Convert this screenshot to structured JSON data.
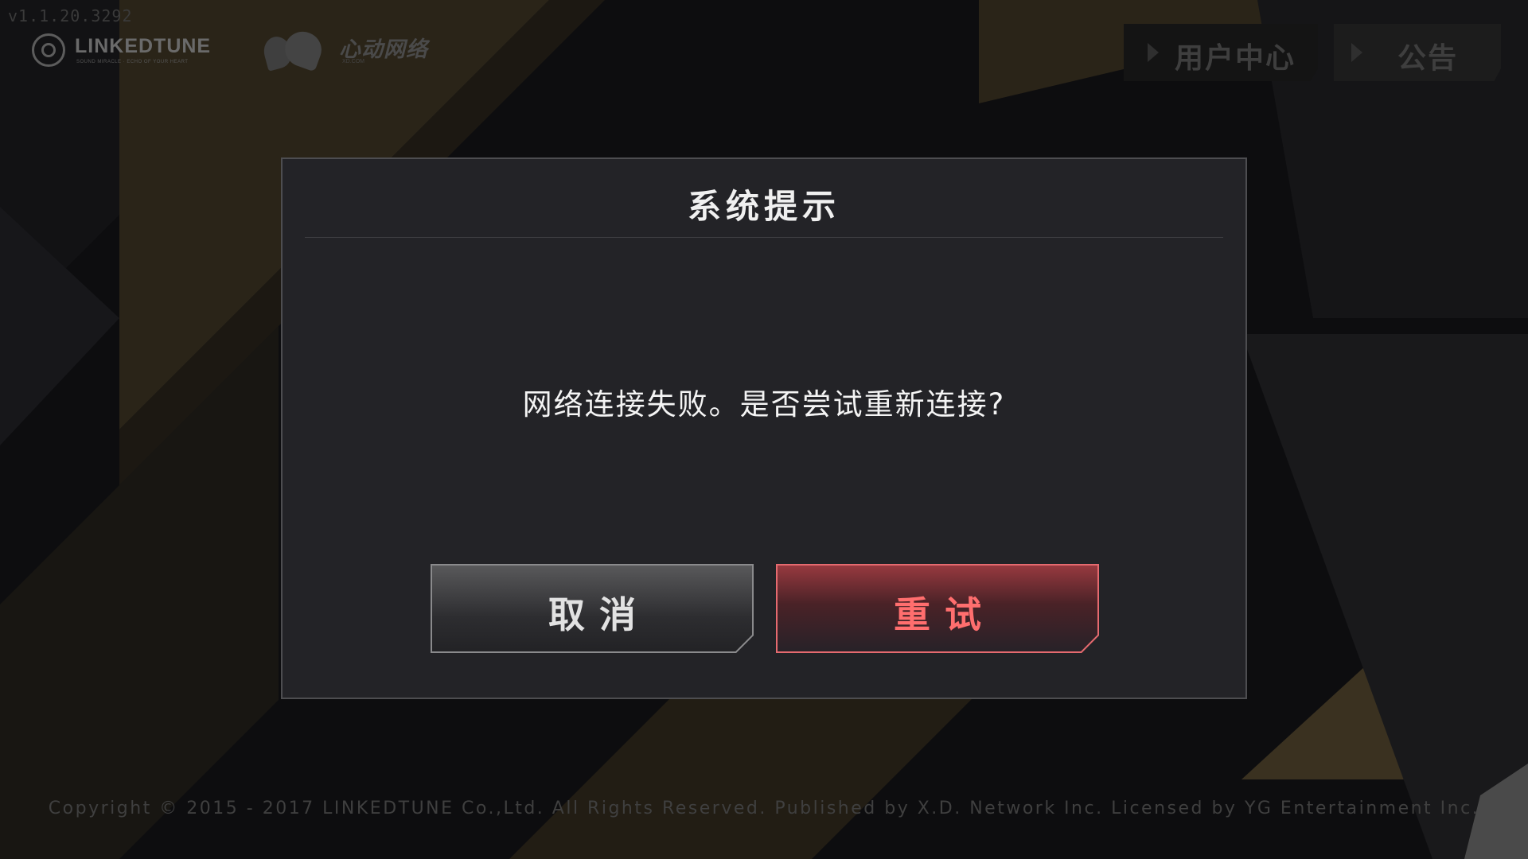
{
  "version": "v1.1.20.3292",
  "logos": {
    "linkedtune": "LINKEDTUNE",
    "linkedtune_tagline": "SOUND MIRACLE · ECHO OF YOUR HEART",
    "xd_name": "心动网络",
    "xd_sub": "XD.COM"
  },
  "header": {
    "user_center": "用户中心",
    "notice": "公告"
  },
  "dialog": {
    "title": "系统提示",
    "message": "网络连接失败。是否尝试重新连接?",
    "cancel_label": "取消",
    "retry_label": "重试"
  },
  "footer": {
    "copyright": "Copyright © 2015 - 2017 LINKEDTUNE Co.,Ltd. All Rights Reserved. Published by X.D. Network Inc. Licensed by YG Entertainment Inc."
  },
  "colors": {
    "dialog_bg": "#232327",
    "retry_accent": "#e56a6f",
    "cancel_border": "#8a8a8c",
    "stripe_gold": "#2b2416"
  }
}
